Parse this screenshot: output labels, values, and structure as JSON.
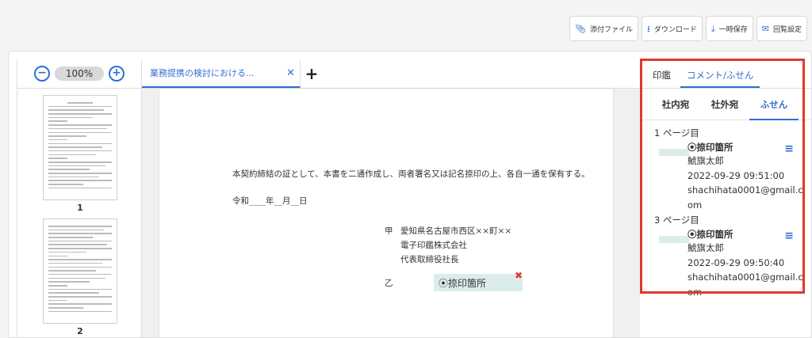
{
  "toolbar": {
    "attach": "添付ファイル",
    "download": "ダウンロード",
    "save": "一時保存",
    "settings": "回覧設定"
  },
  "thumbs": {
    "zoom": "100%",
    "zoom_out": "−",
    "zoom_in": "+",
    "pages": [
      "1",
      "2"
    ]
  },
  "tabs": {
    "doc_title": "業務提携の検討における...",
    "close": "✕",
    "add": "+"
  },
  "doc": {
    "line1": "本契約締結の証として、本書を二通作成し、両者署名又は記名捺印の上、各自一通を保有する。",
    "date": "令和____年__月__日",
    "kou_label": "甲",
    "kou_addr": "愛知県名古屋市西区××町××",
    "kou_company": "電子印鑑株式会社",
    "kou_title": "代表取締役社長",
    "otsu_label": "乙",
    "stamp_text": "⦿捺印箇所",
    "stamp_remove": "✖"
  },
  "right_panel": {
    "tab_seal": "印鑑",
    "tab_comment": "コメント/ふせん",
    "sub_internal": "社内宛",
    "sub_external": "社外宛",
    "sub_sticky": "ふせん",
    "notes": [
      {
        "page": "1 ページ目",
        "title": "⦿捺印箇所",
        "author": "鯱旗太郎",
        "datetime": "2022-09-29 09:51:00",
        "email": "shachihata0001@gmail.com"
      },
      {
        "page": "3 ページ目",
        "title": "⦿捺印箇所",
        "author": "鯱旗太郎",
        "datetime": "2022-09-29 09:50:40",
        "email": "shachihata0001@gmail.com"
      }
    ]
  },
  "colors": {
    "accent": "#2f6fd1",
    "highlight": "#e0392b",
    "sticky": "#dcecea"
  }
}
